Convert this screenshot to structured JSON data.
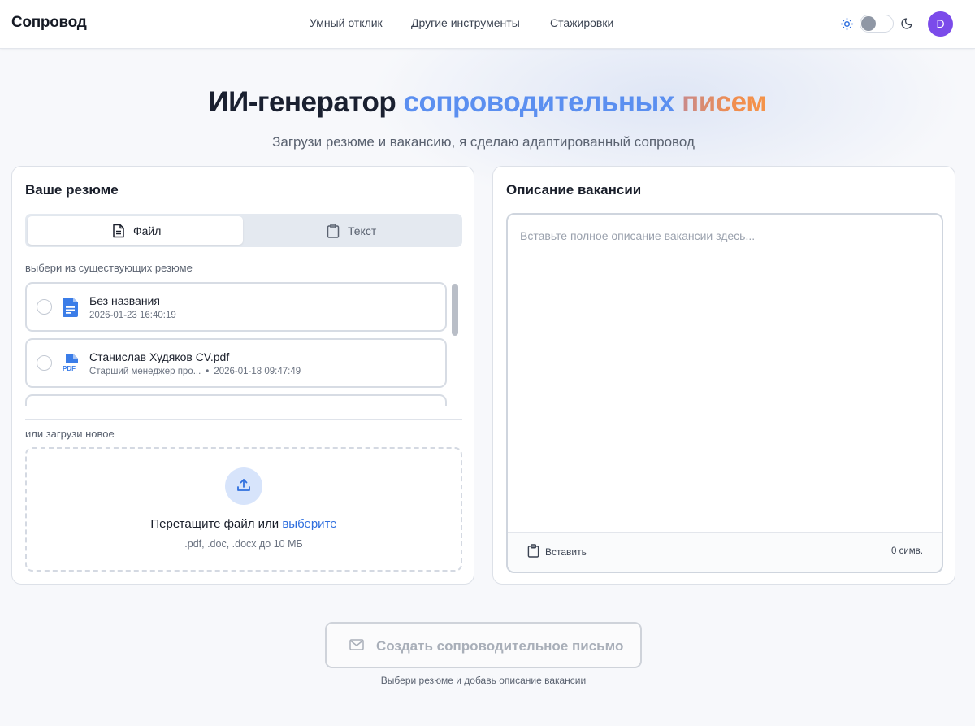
{
  "header": {
    "logo": "Сопровод",
    "nav": [
      "Умный отклик",
      "Другие инструменты",
      "Стажировки"
    ],
    "avatar_initial": "D",
    "theme_toggle": "light"
  },
  "hero": {
    "title_part1": "ИИ-генератор ",
    "title_part2": "сопроводительных ",
    "title_part3": "писем",
    "subtitle": "Загрузи резюме и вакансию, я сделаю адаптированный сопровод"
  },
  "resume_card": {
    "title": "Ваше резюме",
    "tabs": [
      "Файл",
      "Текст"
    ],
    "active_tab": "Файл",
    "choose_label": "выбери из существующих резюме",
    "items": [
      {
        "name": "Без названия",
        "subtitle": "",
        "date": "2026-01-23 16:40:19",
        "icon": "document-icon"
      },
      {
        "name": "Станислав Худяков CV.pdf",
        "subtitle": "Старший менеджер про...",
        "date": "2026-01-18 09:47:49",
        "icon": "pdf-icon"
      }
    ],
    "upload_label": "или загрузи новое",
    "dropzone": {
      "text": "Перетащите файл или ",
      "link": "выберите",
      "hint": ".pdf, .doc, .docx до 10 МБ"
    }
  },
  "vacancy_card": {
    "title": "Описание вакансии",
    "placeholder": "Вставьте полное описание вакансии здесь...",
    "paste_label": "Вставить",
    "char_count": "0 симв."
  },
  "actions": {
    "create_label": "Создать сопроводительное письмо",
    "hint": "Выбери резюме и добавь описание вакансии"
  },
  "colors": {
    "accent_blue": "#5b8ff0",
    "accent_orange": "#f08d4f",
    "avatar": "#7b4bea"
  }
}
